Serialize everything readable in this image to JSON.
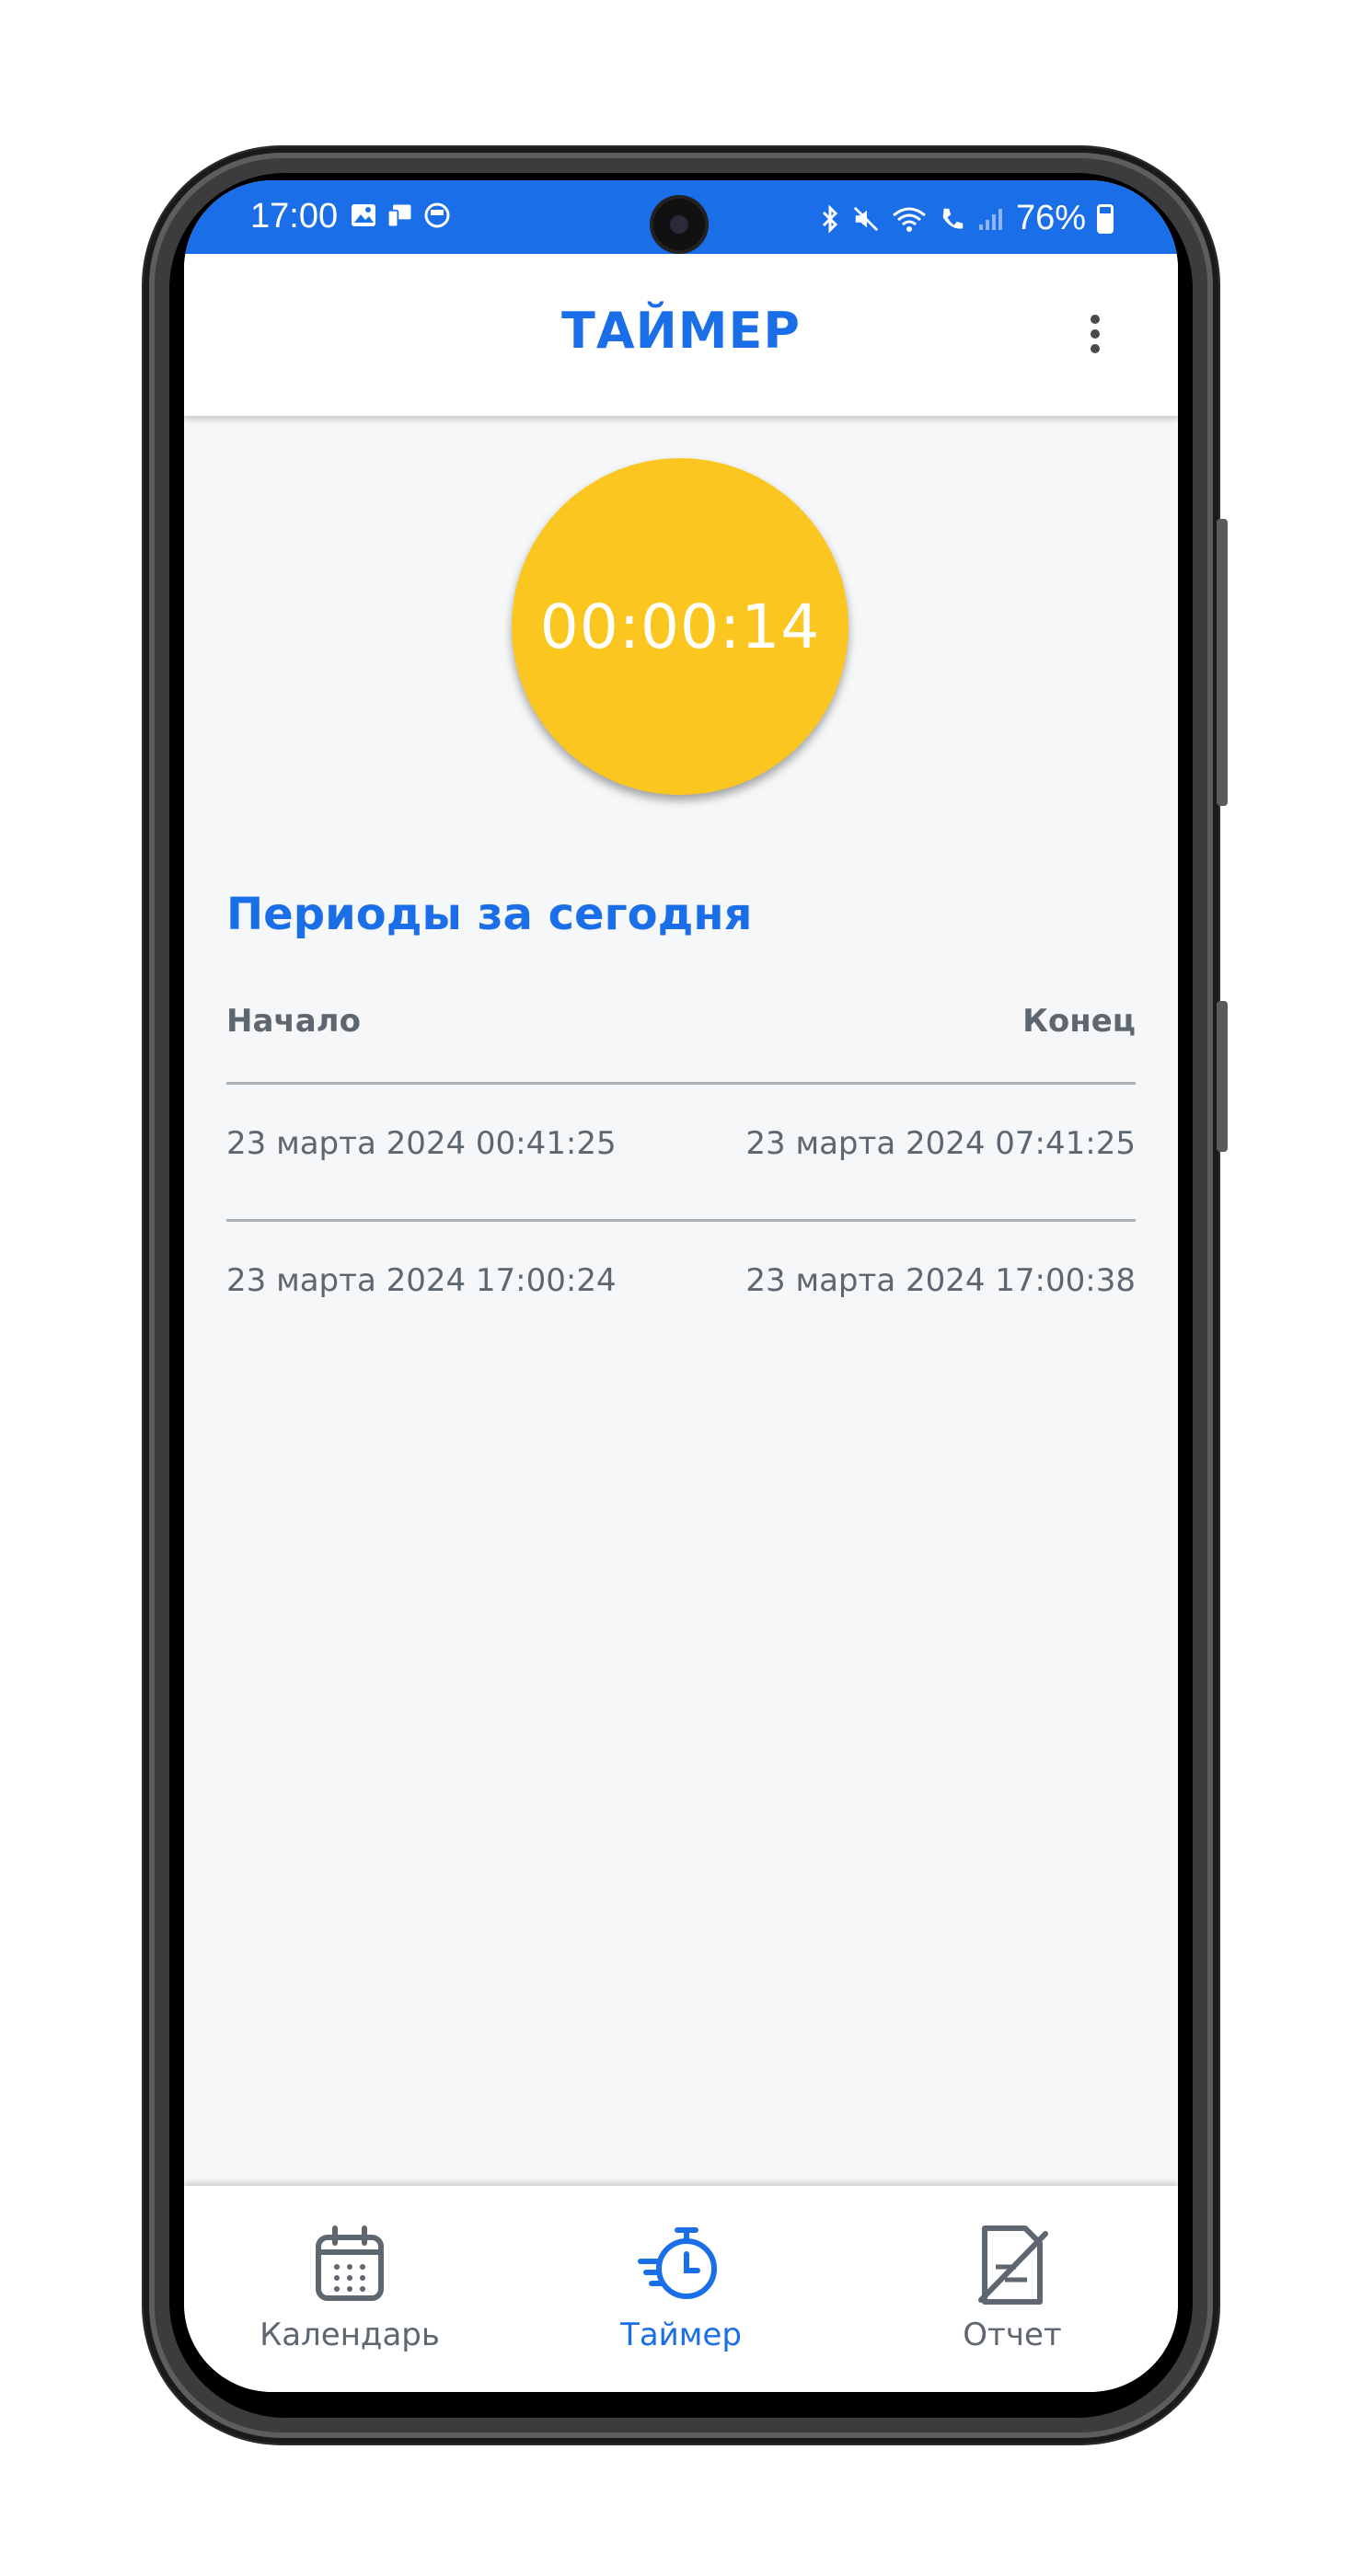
{
  "status_bar": {
    "time": "17:00",
    "battery": "76%"
  },
  "app_bar": {
    "title": "ТАЙМЕР"
  },
  "timer": {
    "value": "00:00:14",
    "color": "#fcc620"
  },
  "periods": {
    "title": "Периоды за сегодня",
    "columns": [
      "Начало",
      "Конец"
    ],
    "rows": [
      {
        "start": "23 марта 2024 00:41:25",
        "end": "23 марта 2024 07:41:25"
      },
      {
        "start": "23 марта 2024 17:00:24",
        "end": "23 марта 2024 17:00:38"
      }
    ]
  },
  "bottom_nav": {
    "items": [
      {
        "label": "Календарь",
        "icon": "calendar-icon",
        "active": false
      },
      {
        "label": "Таймер",
        "icon": "stopwatch-icon",
        "active": true
      },
      {
        "label": "Отчет",
        "icon": "report-icon",
        "active": false
      }
    ]
  },
  "colors": {
    "accent": "#1a6fe8",
    "status_bar": "#1a6fe8",
    "text_secondary": "#5e6670",
    "background": "#f5f7f9"
  }
}
